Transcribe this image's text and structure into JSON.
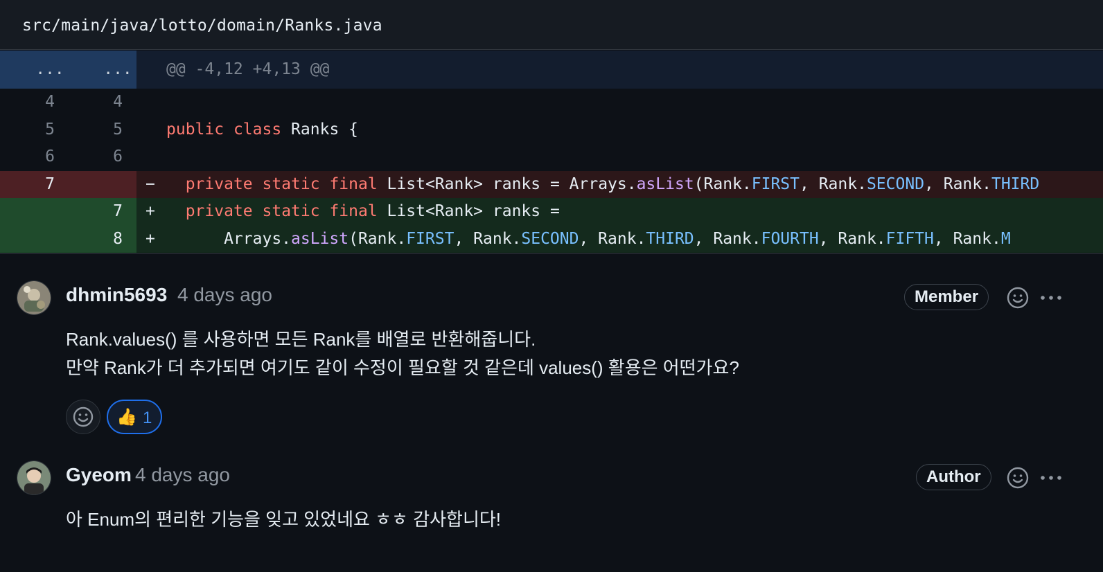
{
  "file": {
    "path": "src/main/java/lotto/domain/Ranks.java"
  },
  "hunk": {
    "old": "...",
    "new": "...",
    "header": "@@ -4,12 +4,13 @@"
  },
  "lines": {
    "l1": {
      "old": "4",
      "new": "4"
    },
    "l2": {
      "old": "5",
      "new": "5",
      "kw1": "public",
      "kw2": "class",
      "rest": " Ranks {"
    },
    "l3": {
      "old": "6",
      "new": "6"
    },
    "del": {
      "old": "7",
      "marker": "−",
      "indent": "  ",
      "kw1": "private",
      "kw2": "static",
      "kw3": "final",
      "t1": " List<Rank> ranks = Arrays.",
      "fn": "asList",
      "t2": "(Rank.",
      "c1": "FIRST",
      "t3": ", Rank.",
      "c2": "SECOND",
      "t4": ", Rank.",
      "c3": "THIRD"
    },
    "add1": {
      "new": "7",
      "marker": "+",
      "indent": "  ",
      "kw1": "private",
      "kw2": "static",
      "kw3": "final",
      "t1": " List<Rank> ranks ="
    },
    "add2": {
      "new": "8",
      "marker": "+",
      "t0": "      Arrays.",
      "fn": "asList",
      "t1": "(Rank.",
      "c1": "FIRST",
      "t2": ", Rank.",
      "c2": "SECOND",
      "t3": ", Rank.",
      "c3": "THIRD",
      "t4": ", Rank.",
      "c4": "FOURTH",
      "t5": ", Rank.",
      "c5": "FIFTH",
      "t6": ", Rank.",
      "c6": "M"
    }
  },
  "comments": [
    {
      "author": "dhmin5693",
      "time": "4 days ago",
      "role": "Member",
      "body_line1": "Rank.values() 를 사용하면 모든 Rank를 배열로 반환해줍니다.",
      "body_line2": "만약 Rank가 더 추가되면 여기도 같이 수정이 필요할 것 같은데 values() 활용은 어떤가요?",
      "reaction_emoji": "👍",
      "reaction_count": "1"
    },
    {
      "author": "Gyeom",
      "time": "4 days ago",
      "role": "Author",
      "body_line1": "아 Enum의 편리한 기능을 잊고 있었네요 ㅎㅎ 감사합니다!"
    }
  ],
  "icons": {
    "reaction_add": "smiley-icon",
    "more": "kebab-horizontal-icon",
    "avatar1": "avatar",
    "avatar2": "avatar"
  },
  "colors": {
    "background": "#0d1117",
    "deletion": "#4d2024",
    "addition": "#1f4b2c",
    "keyword": "#ff7b72",
    "function": "#d2a8ff",
    "constant": "#79c0ff",
    "reaction_border": "#1f6feb"
  }
}
